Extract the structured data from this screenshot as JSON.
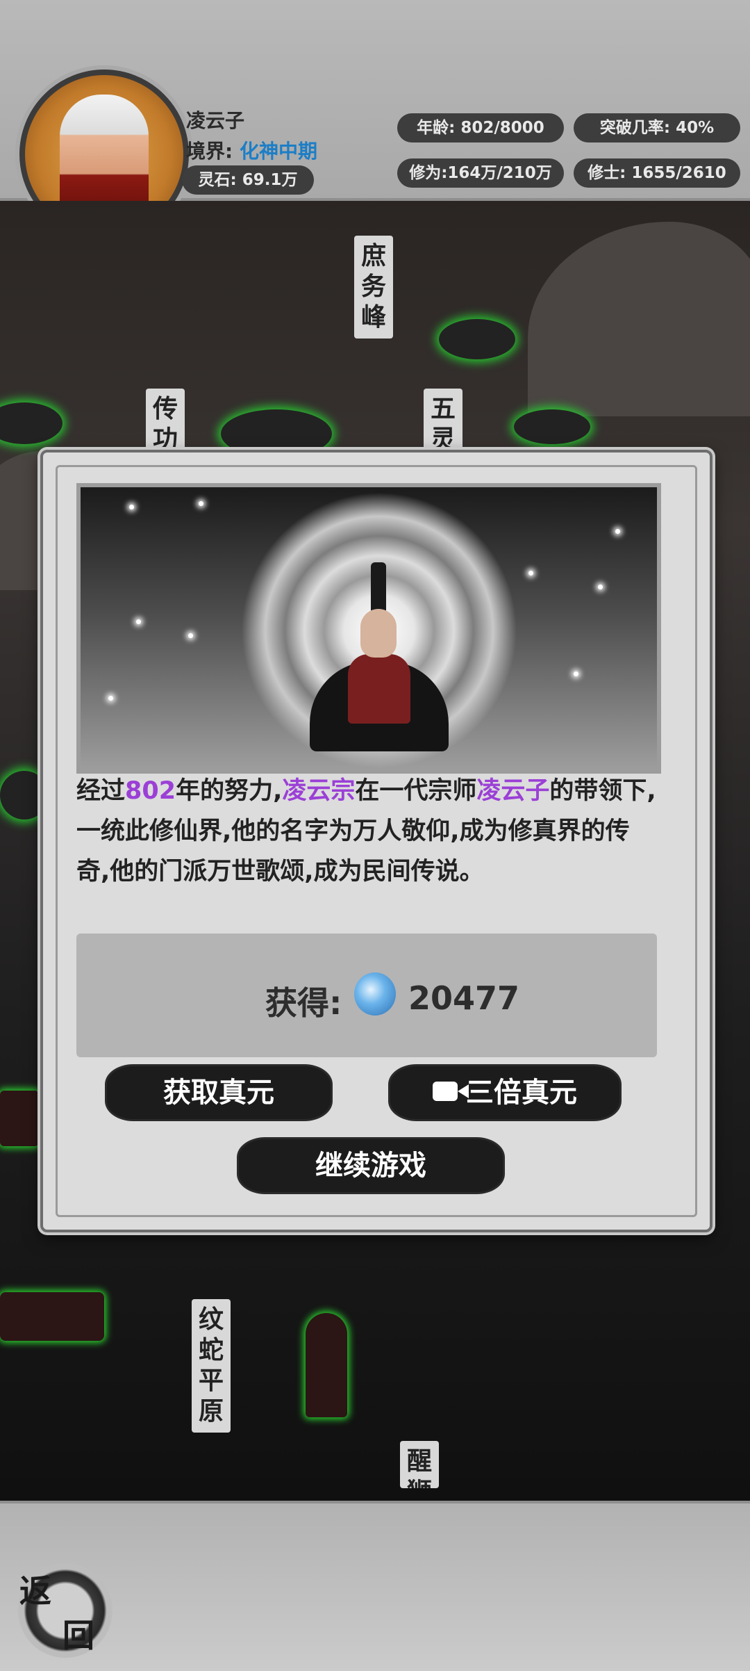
{
  "player": {
    "name": "凌云子",
    "realm_label": "境界:",
    "realm_value": "化神中期",
    "spirit_stones": "灵石: 69.1万"
  },
  "stats": {
    "age": "年龄: 802/8000",
    "breakthrough": "突破几率: 40%",
    "cultivation": "修为:164万/210万",
    "cultivators": "修士: 1655/2610"
  },
  "map_locations": {
    "loc1": "庶务峰",
    "loc2": "传功",
    "loc3": "五灵",
    "loc4": "纹蛇平原",
    "loc5": "醒狮"
  },
  "dialog": {
    "story": {
      "p1": "经过",
      "years": "802",
      "p2": "年的努力,",
      "sect": "凌云宗",
      "p3": "在一代宗师",
      "master": "凌云子",
      "p4": "的带领下,一统此修仙界,他的名字为万人敬仰,成为修真界的传奇,他的门派万世歌颂,成为民间传说。"
    },
    "reward_label": "获得:",
    "reward_amount": "20477",
    "btn_get": "获取真元",
    "btn_triple": "三倍真元",
    "btn_continue": "继续游戏"
  },
  "bottom": {
    "back_char1": "返",
    "back_char2": "回"
  },
  "colors": {
    "highlight_purple": "#9b3fd6",
    "realm_blue": "#1c7ec6",
    "glow_green": "#27c92f"
  }
}
